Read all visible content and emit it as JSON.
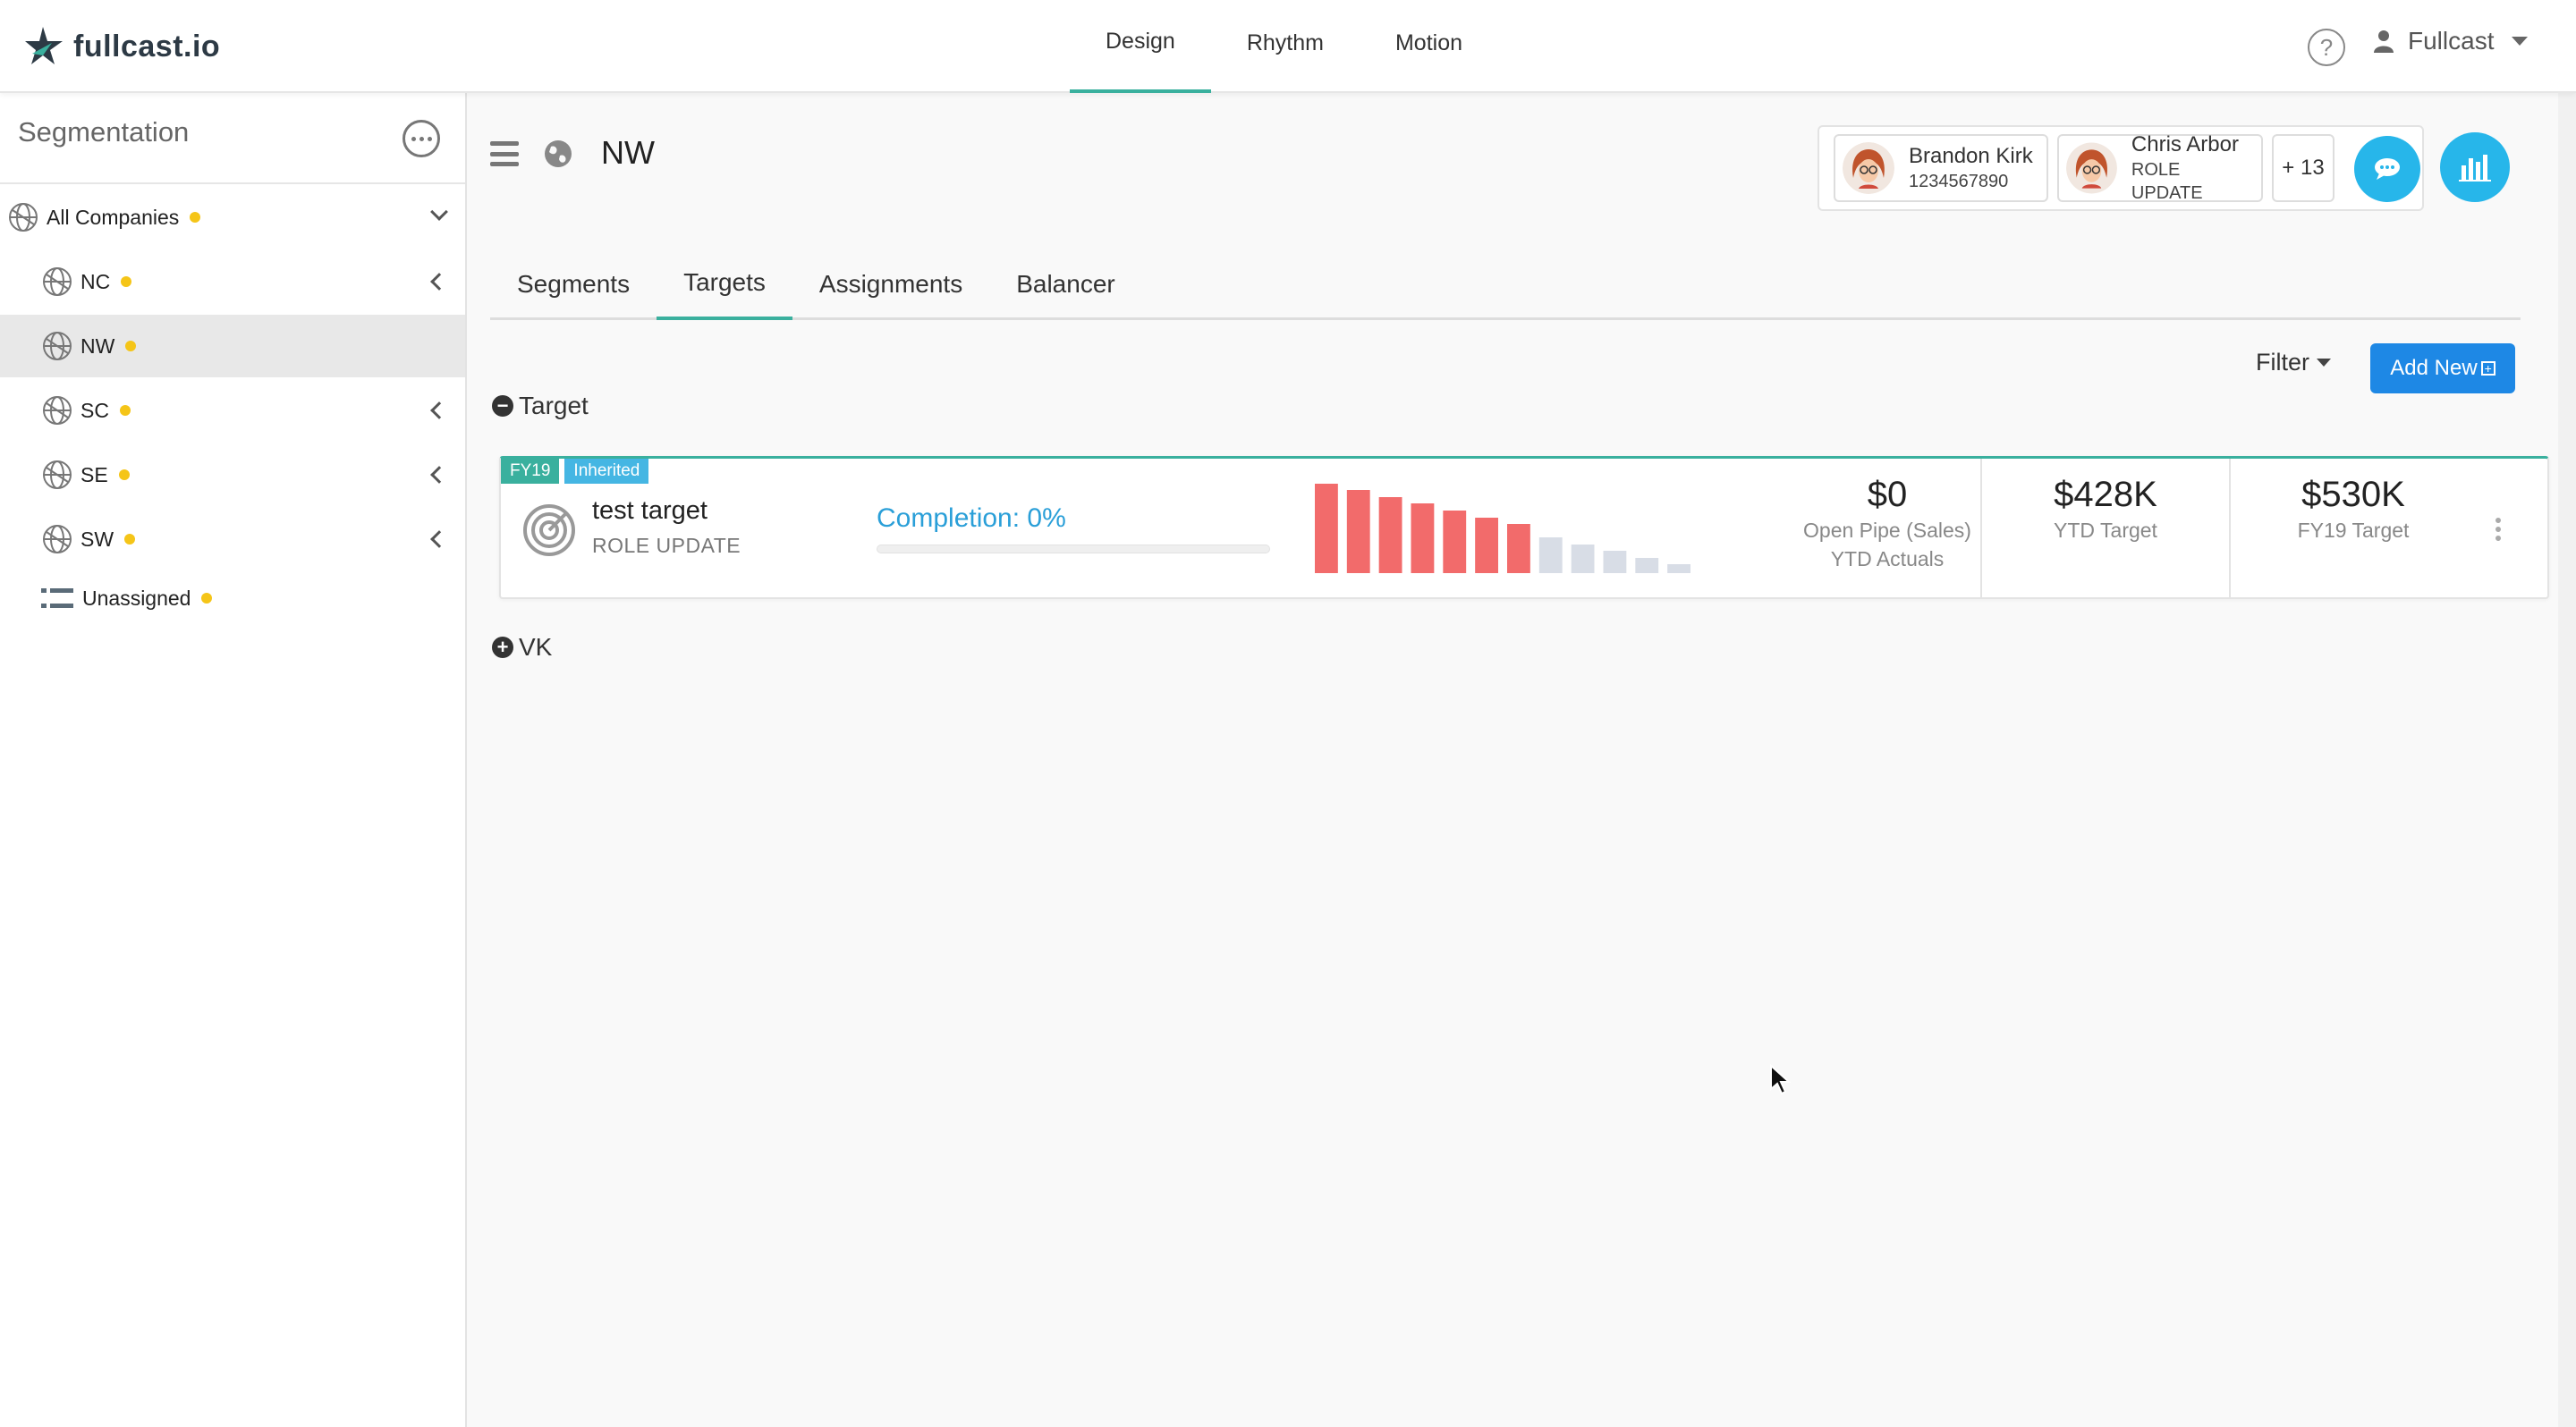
{
  "app": {
    "logo_text": "fullcast.io",
    "nav_tabs": [
      "Design",
      "Rhythm",
      "Motion"
    ],
    "active_nav": "Design",
    "help_label": "?",
    "user_name": "Fullcast"
  },
  "sidebar": {
    "title": "Segmentation",
    "items": [
      {
        "label": "All Companies",
        "status_color": "#f5c518",
        "expanded": true
      },
      {
        "label": "NC",
        "status_color": "#f5c518"
      },
      {
        "label": "NW",
        "status_color": "#f5c518",
        "selected": true
      },
      {
        "label": "SC",
        "status_color": "#f5c518"
      },
      {
        "label": "SE",
        "status_color": "#f5c518"
      },
      {
        "label": "SW",
        "status_color": "#f5c518"
      },
      {
        "label": "Unassigned",
        "status_color": "#f5c518"
      }
    ]
  },
  "header": {
    "title": "NW",
    "collaborators": [
      {
        "name": "Brandon Kirk",
        "sub": "1234567890"
      },
      {
        "name": "Chris Arbor",
        "sub": "ROLE UPDATE"
      }
    ],
    "more_count": "+ 13"
  },
  "tabs": [
    "Segments",
    "Targets",
    "Assignments",
    "Balancer"
  ],
  "active_tab": "Targets",
  "toolbar": {
    "filter_label": "Filter",
    "add_new_label": "Add New"
  },
  "sections": {
    "target_label": "Target",
    "vk_label": "VK"
  },
  "card": {
    "badge_fy": "FY19",
    "badge_inherited": "Inherited",
    "name": "test target",
    "subtitle": "ROLE UPDATE",
    "completion_label": "Completion: 0%",
    "completion_percent": 0,
    "sparkline": {
      "type": "bar",
      "values": [
        100,
        93,
        85,
        78,
        70,
        62,
        55,
        40,
        32,
        25,
        17,
        10
      ],
      "colors": [
        "#f26b6b",
        "#f26b6b",
        "#f26b6b",
        "#f26b6b",
        "#f26b6b",
        "#f26b6b",
        "#f26b6b",
        "#d8dde6",
        "#d8dde6",
        "#d8dde6",
        "#d8dde6",
        "#d8dde6"
      ]
    },
    "metrics": [
      {
        "value": "$0",
        "label1": "Open Pipe (Sales)",
        "label2": "YTD Actuals"
      },
      {
        "value": "$428K",
        "label1": "YTD Target"
      },
      {
        "value": "$530K",
        "label1": "FY19 Target"
      }
    ]
  },
  "colors": {
    "accent": "#3ab09e",
    "primary_button": "#1e88e5",
    "round_button": "#27b6ea",
    "completion_text": "#2a9fd8"
  }
}
